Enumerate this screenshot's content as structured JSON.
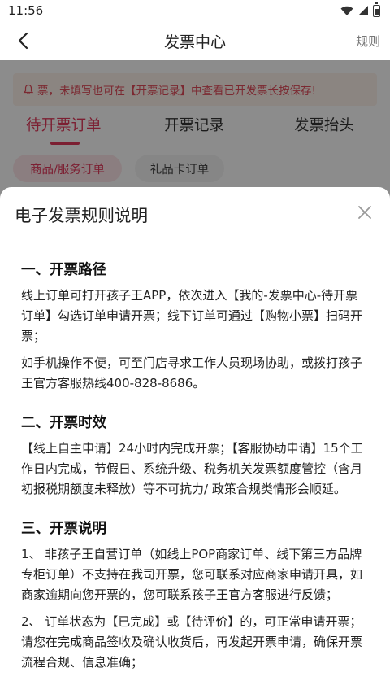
{
  "status_bar": {
    "time": "11:56"
  },
  "nav": {
    "title": "发票中心",
    "rules": "规则"
  },
  "notice": {
    "text": "票，未填写也可在【开票记录】中查看已开发票长按保存!"
  },
  "tabs": [
    {
      "label": "待开票订单",
      "active": true
    },
    {
      "label": "开票记录",
      "active": false
    },
    {
      "label": "发票抬头",
      "active": false
    }
  ],
  "chips": [
    {
      "label": "商品/服务订单",
      "active": true
    },
    {
      "label": "礼品卡订单",
      "active": false
    }
  ],
  "sheet": {
    "title": "电子发票规则说明",
    "sections": [
      {
        "heading": "一、开票路径",
        "paragraphs": [
          "线上订单可打开孩子王APP，依次进入【我的-发票中心-待开票订单】勾选订单申请开票；线下订单可通过【购物小票】扫码开票；",
          "如手机操作不便，可至门店寻求工作人员现场协助，或拨打孩子王官方客服热线400-828-8686。"
        ]
      },
      {
        "heading": "二、开票时效",
        "paragraphs": [
          "【线上自主申请】24小时内完成开票；【客服协助申请】15个工作日内完成，节假日、系统升级、税务机关发票额度管控（含月初报税期额度未释放）等不可抗力/ 政策合规类情形会顺延。"
        ]
      },
      {
        "heading": "三、开票说明",
        "paragraphs": [
          "1、 非孩子王自营订单（如线上POP商家订单、线下第三方品牌专柜订单）不支持在我司开票，您可联系对应商家申请开具，如商家逾期向您开票的，您可联系孩子王官方客服进行反馈；",
          "2、 订单状态为【已完成】或【待评价】的，可正常申请开票；请您在完成商品签收及确认收货后，再发起开票申请，确保开票流程合规、信息准确；"
        ]
      }
    ]
  }
}
